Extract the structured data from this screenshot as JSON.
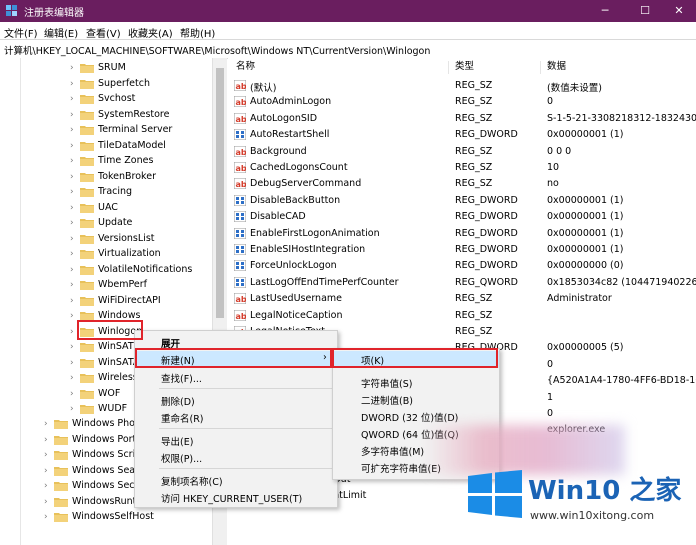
{
  "window": {
    "title": "注册表编辑器",
    "buttons": {
      "minimize": "─",
      "maximize": "☐",
      "close": "✕"
    }
  },
  "menu": [
    "文件(F)",
    "编辑(E)",
    "查看(V)",
    "收藏夹(A)",
    "帮助(H)"
  ],
  "address": "计算机\\HKEY_LOCAL_MACHINE\\SOFTWARE\\Microsoft\\Windows NT\\CurrentVersion\\Winlogon",
  "tree": {
    "items": [
      "SRUM",
      "Superfetch",
      "Svchost",
      "SystemRestore",
      "Terminal Server",
      "TileDataModel",
      "Time Zones",
      "TokenBroker",
      "Tracing",
      "UAC",
      "Update",
      "VersionsList",
      "Virtualization",
      "VolatileNotifications",
      "WbemPerf",
      "WiFiDirectAPI",
      "Windows",
      "Winlogon",
      "WinSAT",
      "WinSATA",
      "Wireless",
      "WOF",
      "WUDF"
    ],
    "parent_items": [
      "Windows Phot",
      "Windows Porta",
      "Windows Scrip",
      "Windows Sear",
      "Windows Secu",
      "WindowsRunti",
      "WindowsSelfHost"
    ]
  },
  "list": {
    "headers": {
      "name": "名称",
      "type": "类型",
      "data": "数据"
    },
    "rows": [
      {
        "name": "(默认)",
        "type": "REG_SZ",
        "data": "(数值未设置)",
        "icon": "string-value-icon"
      },
      {
        "name": "AutoAdminLogon",
        "type": "REG_SZ",
        "data": "0",
        "icon": "string-value-icon"
      },
      {
        "name": "AutoLogonSID",
        "type": "REG_SZ",
        "data": "S-1-5-21-3308218312-1832430",
        "icon": "string-value-icon"
      },
      {
        "name": "AutoRestartShell",
        "type": "REG_DWORD",
        "data": "0x00000001 (1)",
        "icon": "binary-value-icon"
      },
      {
        "name": "Background",
        "type": "REG_SZ",
        "data": "0 0 0",
        "icon": "string-value-icon"
      },
      {
        "name": "CachedLogonsCount",
        "type": "REG_SZ",
        "data": "10",
        "icon": "string-value-icon"
      },
      {
        "name": "DebugServerCommand",
        "type": "REG_SZ",
        "data": "no",
        "icon": "string-value-icon"
      },
      {
        "name": "DisableBackButton",
        "type": "REG_DWORD",
        "data": "0x00000001 (1)",
        "icon": "binary-value-icon"
      },
      {
        "name": "DisableCAD",
        "type": "REG_DWORD",
        "data": "0x00000001 (1)",
        "icon": "binary-value-icon"
      },
      {
        "name": "EnableFirstLogonAnimation",
        "type": "REG_DWORD",
        "data": "0x00000001 (1)",
        "icon": "binary-value-icon"
      },
      {
        "name": "EnableSIHostIntegration",
        "type": "REG_DWORD",
        "data": "0x00000001 (1)",
        "icon": "binary-value-icon"
      },
      {
        "name": "ForceUnlockLogon",
        "type": "REG_DWORD",
        "data": "0x00000000 (0)",
        "icon": "binary-value-icon"
      },
      {
        "name": "LastLogOffEndTimePerfCounter",
        "type": "REG_QWORD",
        "data": "0x1853034c82 (104471940226)",
        "icon": "binary-value-icon"
      },
      {
        "name": "LastUsedUsername",
        "type": "REG_SZ",
        "data": "Administrator",
        "icon": "string-value-icon"
      },
      {
        "name": "LegalNoticeCaption",
        "type": "REG_SZ",
        "data": "",
        "icon": "string-value-icon"
      },
      {
        "name": "LegalNoticeText",
        "type": "REG_SZ",
        "data": "",
        "icon": "string-value-icon"
      },
      {
        "name": "ing",
        "type": "REG_DWORD",
        "data": "0x00000005 (5)",
        "icon": "binary-value-icon"
      },
      {
        "name": "",
        "type": "",
        "data": "0",
        "icon": "string-value-icon"
      },
      {
        "name": "",
        "type": "",
        "data": "{A520A1A4-1780-4FF6-BD18-16",
        "icon": "string-value-icon"
      },
      {
        "name": "",
        "type": "",
        "data": "1",
        "icon": "string-value-icon"
      },
      {
        "name": "",
        "type": "",
        "data": "0",
        "icon": "string-value-icon"
      },
      {
        "name": "",
        "type": "",
        "data": "explorer.exe",
        "icon": "string-value-icon"
      },
      {
        "name": "",
        "type": "",
        "data": "",
        "icon": "string-value-icon"
      },
      {
        "name": "",
        "type": "",
        "data": "",
        "icon": "string-value-icon"
      },
      {
        "name": "SIHostReadyTimeOut",
        "type": "",
        "data": "",
        "icon": "binary-value-icon"
      },
      {
        "name": "SIHostRestartCountLimit",
        "type": "",
        "data": "",
        "icon": "binary-value-icon"
      }
    ]
  },
  "context_menu": {
    "items": [
      "展开",
      "新建(N)",
      "查找(F)...",
      "删除(D)",
      "重命名(R)",
      "导出(E)",
      "权限(P)...",
      "复制项名称(C)",
      "访问 HKEY_CURRENT_USER(T)"
    ],
    "arrow": "›"
  },
  "submenu": {
    "items": [
      "项(K)",
      "字符串值(S)",
      "二进制值(B)",
      "DWORD (32 位)值(D)",
      "QWORD (64 位)值(Q)",
      "多字符串值(M)",
      "可扩充字符串值(E)"
    ]
  },
  "watermark": {
    "text": "Win10 之家",
    "site": "www.win10xitong.com"
  },
  "colors": {
    "titlebar": "#6a1e5f",
    "highlight_box": "#e0242b",
    "menu_hover": "#cce8ff",
    "folder": "#e8c15a",
    "watermark_blue": "#1b63b5"
  }
}
